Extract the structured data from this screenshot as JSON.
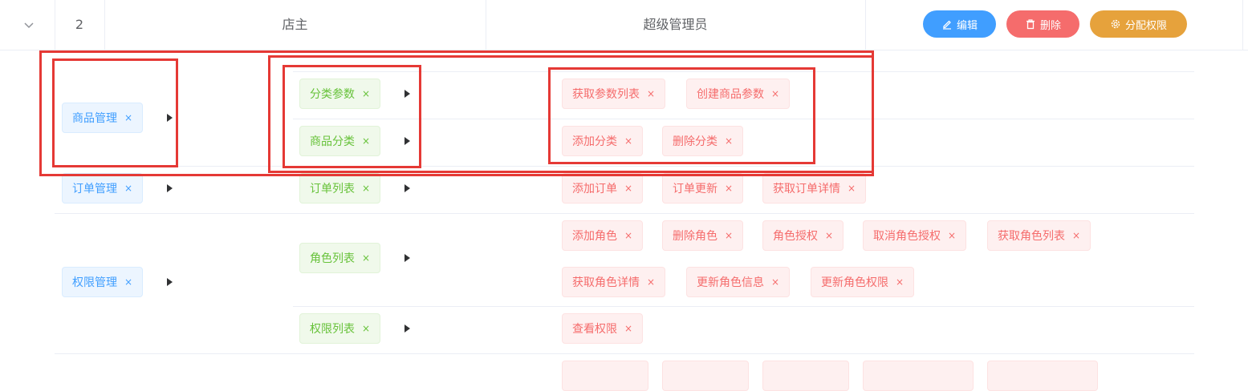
{
  "row": {
    "index": "2",
    "role_name": "店主",
    "role_desc": "超级管理员",
    "buttons": {
      "edit": "编辑",
      "delete": "删除",
      "assign": "分配权限"
    }
  },
  "rights": {
    "l1": [
      "商品管理",
      "订单管理",
      "权限管理"
    ],
    "l2": [
      "分类参数",
      "商品分类",
      "订单列表",
      "角色列表",
      "权限列表"
    ],
    "l3": {
      "cat_params": [
        "获取参数列表",
        "创建商品参数"
      ],
      "goods_cat": [
        "添加分类",
        "删除分类"
      ],
      "order_list": [
        "添加订单",
        "订单更新",
        "获取订单详情"
      ],
      "role_list": [
        "添加角色",
        "删除角色",
        "角色授权",
        "取消角色授权",
        "获取角色列表",
        "获取角色详情",
        "更新角色信息",
        "更新角色权限"
      ],
      "rights_list": [
        "查看权限"
      ]
    }
  },
  "tag_close_glyph": "×",
  "colors": {
    "primary": "#409eff",
    "danger": "#f56c6c",
    "warning": "#e6a23c",
    "success": "#67c23a",
    "annotation": "#e53935"
  }
}
